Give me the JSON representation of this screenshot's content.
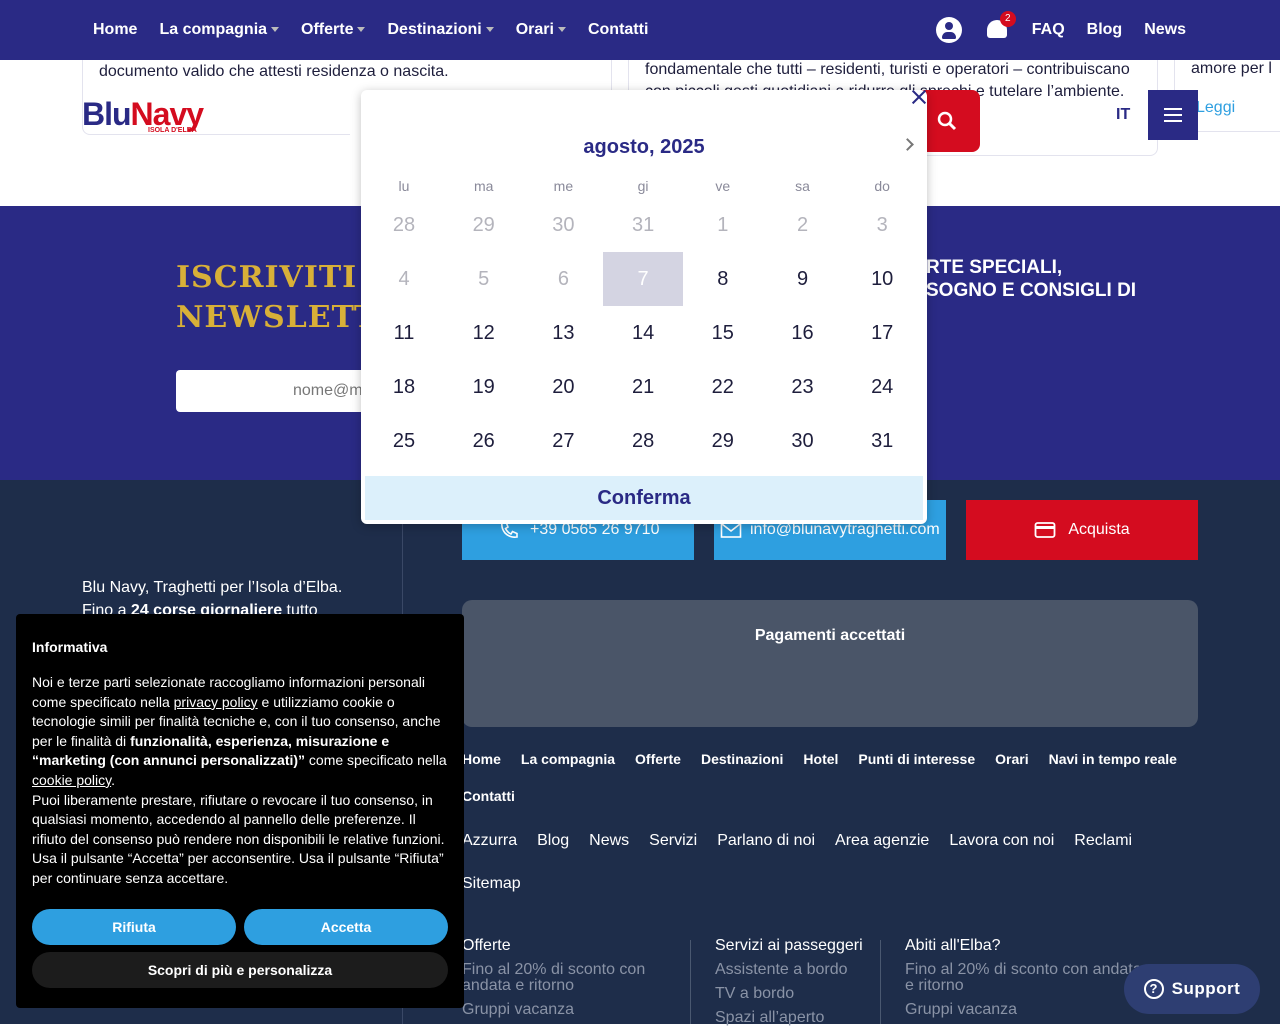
{
  "nav": {
    "items": [
      "Home",
      "La compagnia",
      "Offerte",
      "Destinazioni",
      "Orari",
      "Contatti"
    ],
    "notif_count": "2",
    "right_links": [
      "FAQ",
      "Blog",
      "News"
    ]
  },
  "cards": {
    "text1": "documento valido che attesti residenza o nascita.",
    "text2a": "fondamentale che tutti – residenti, turisti e operatori – contribuiscano",
    "text2b": "con piccoli gesti quotidiani a ridurre gli sprechi e tutelare l’ambiente.",
    "text3": "amore per l",
    "read_more": "Leggi"
  },
  "header": {
    "logo_main": "Blu",
    "logo_accent": "Navy",
    "logo_sub": "ISOLA D'ELBA",
    "lang": "IT"
  },
  "newsletter": {
    "title_line1": "ISCRIVITI",
    "title_line2": "NEWSLETTER",
    "right_line1": "RTE SPECIALI,",
    "right_line2": "SOGNO E CONSIGLI DI",
    "email_placeholder": "nome@m"
  },
  "footer": {
    "phone": "+39 0565 26 9710",
    "email": "info@blunavytraghetti.com",
    "buy": "Acquista",
    "about_line1": "Blu Navy, Traghetti per l’Isola d’Elba.",
    "about_line2_pre": "Fino a ",
    "about_line2_bold": "24 corse giornaliere",
    "about_line2_post": " tutto",
    "payments_title": "Pagamenti accettati",
    "links_primary": [
      "Home",
      "La compagnia",
      "Offerte",
      "Destinazioni",
      "Hotel",
      "Punti di interesse",
      "Orari",
      "Navi in tempo reale",
      "Contatti"
    ],
    "links_secondary": [
      "Azzurra",
      "Blog",
      "News",
      "Servizi",
      "Parlano di noi",
      "Area agenzie",
      "Lavora con noi",
      "Reclami",
      "Sitemap"
    ],
    "col1": {
      "title": "Offerte",
      "items": [
        "Fino al 20% di sconto con andata e ritorno",
        "Gruppi vacanza"
      ]
    },
    "col2": {
      "title": "Servizi ai passeggeri",
      "items": [
        "Assistente a bordo",
        "TV a bordo",
        "Spazi all’aperto"
      ]
    },
    "col3": {
      "title": "Abiti all'Elba?",
      "items": [
        "Fino al 20% di sconto con andata e ritorno",
        "Gruppi vacanza"
      ]
    }
  },
  "datepicker": {
    "month_label": "agosto, 2025",
    "weekdays": [
      "lu",
      "ma",
      "me",
      "gi",
      "ve",
      "sa",
      "do"
    ],
    "weeks": [
      [
        "28",
        "29",
        "30",
        "31",
        "1",
        "2",
        "3"
      ],
      [
        "4",
        "5",
        "6",
        "7",
        "8",
        "9",
        "10"
      ],
      [
        "11",
        "12",
        "13",
        "14",
        "15",
        "16",
        "17"
      ],
      [
        "18",
        "19",
        "20",
        "21",
        "22",
        "23",
        "24"
      ],
      [
        "25",
        "26",
        "27",
        "28",
        "29",
        "30",
        "31"
      ]
    ],
    "selected_day": "7",
    "confirm": "Conferma"
  },
  "cookie": {
    "title": "Informativa",
    "p1_a": "Noi e terze parti selezionate raccogliamo informazioni personali come specificato nella ",
    "privacy_link": "privacy policy",
    "p1_b": " e utilizziamo cookie o tecnologie simili per finalità tecniche e, con il tuo consenso, anche per le finalità di ",
    "p1_bold": "funzionalità, esperienza, misurazione e “marketing (con annunci personalizzati)”",
    "p1_c": " come specificato nella ",
    "cookie_link": "cookie policy",
    "p1_d": ".",
    "p2": "Puoi liberamente prestare, rifiutare o revocare il tuo consenso, in qualsiasi momento, accedendo al pannello delle preferenze. Il rifiuto del consenso può rendere non disponibili le relative funzioni. Usa il pulsante “Accetta” per acconsentire. Usa il pulsante “Rifiuta” per continuare senza accettare.",
    "reject": "Rifiuta",
    "accept": "Accetta",
    "more": "Scopri di più e personalizza"
  },
  "support": {
    "label": "Support"
  },
  "colors": {
    "navy": "#2a2a85",
    "red": "#d40c1f",
    "gold": "#d8b038",
    "sky": "#2e9fe0",
    "footer": "#1e2d4a"
  }
}
